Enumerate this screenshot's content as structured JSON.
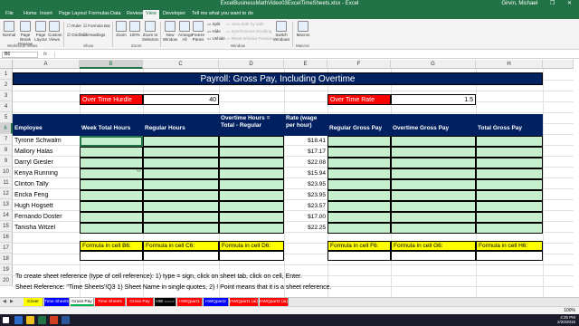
{
  "app": {
    "title": "ExcelBusinessMathVideo03ExcelTimeSheets.xlsx - Excel",
    "user": "Girvin, Michael"
  },
  "window_controls": "—  ❐  ✕",
  "ribbon_tabs": [
    "File",
    "Home",
    "Insert",
    "Page Layout",
    "Formulas",
    "Data",
    "Review",
    "View",
    "Developer",
    "Tell me what you want to do"
  ],
  "ribbon": {
    "normal": "Normal",
    "page_break": "Page Break Preview",
    "page_layout": "Page Layout",
    "custom_views": "Custom Views",
    "ruler": "Ruler",
    "formula_bar": "Formula Bar",
    "gridlines": "Gridlines",
    "headings": "Headings",
    "zoom": "Zoom",
    "zoom100": "100%",
    "zoom_sel": "Zoom to Selection",
    "new_window": "New Window",
    "arrange_all": "Arrange All",
    "freeze": "Freeze Panes",
    "split": "Split",
    "hide": "Hide",
    "unhide": "Unhide",
    "view_side": "View Side by Side",
    "sync_scroll": "Synchronous Scrolling",
    "reset_pos": "Reset Window Position",
    "switch": "Switch Windows",
    "macros": "Macros",
    "grp_views": "Workbook Views",
    "grp_show": "Show",
    "grp_zoom": "Zoom",
    "grp_window": "Window",
    "grp_macros": "Macros"
  },
  "formula_bar": {
    "name_box": "B6",
    "fx": "fx",
    "value": ""
  },
  "columns": [
    "A",
    "B",
    "C",
    "D",
    "E",
    "F",
    "G",
    "H"
  ],
  "rows": [
    "1",
    "2",
    "3",
    "4",
    "5",
    "6",
    "7",
    "8",
    "9",
    "10",
    "11",
    "12",
    "13",
    "14",
    "15",
    "16",
    "17",
    "18",
    "19",
    "20"
  ],
  "sheet": {
    "title": "Payroll: Gross Pay, Including Overtime",
    "ot_hurdle_label": "Over Time Hurdle",
    "ot_hurdle_value": "40",
    "ot_rate_label": "Over Time Rate",
    "ot_rate_value": "1.5",
    "headers": [
      "Employee",
      "Week Total Hours",
      "Regular Hours",
      "Overtime Hours = Total - Regular",
      "Rate (wage per hour)",
      "Regular Gross Pay",
      "Overtime Gross Pay",
      "Total Gross Pay"
    ],
    "employees": [
      {
        "name": "Tyrone Schwalm",
        "rate": "$18.41"
      },
      {
        "name": "Mallory Halas",
        "rate": "$17.17"
      },
      {
        "name": "Darryl Giesler",
        "rate": "$22.08"
      },
      {
        "name": "Kenya Running",
        "rate": "$15.94"
      },
      {
        "name": "Clinton Tally",
        "rate": "$23.95"
      },
      {
        "name": "Ericka Feng",
        "rate": "$23.95"
      },
      {
        "name": "Hugh Hogsett",
        "rate": "$23.57"
      },
      {
        "name": "Fernando Doster",
        "rate": "$17.00"
      },
      {
        "name": "Tanisha Witzel",
        "rate": "$22.25"
      }
    ],
    "formula_labels": [
      "Formula in cell B6:",
      "Formula in cell C6:",
      "Formula in cell D6:",
      "Formula in cell F6:",
      "Formula in cell G6:",
      "Formula in cell H6:"
    ],
    "note1": "To create sheet reference (type of cell reference): 1) type = sign, click on sheet tab, click on cell, Enter.",
    "note2": "Sheet Reference: \"Time Sheets'!Q3     1) Sheet Name in single quotes, 2) ! Point means that it is a sheet reference."
  },
  "sheet_tabs": [
    {
      "label": "Cover",
      "color": "#ffff00",
      "text": "#000000"
    },
    {
      "label": "Time Sheets",
      "color": "#0000ff",
      "text": "#ffffff"
    },
    {
      "label": "Gross Pay",
      "color": "#00b050",
      "text": "#000000"
    },
    {
      "label": "Time Sheets (ai)",
      "color": "#ff0000",
      "text": "#ffffff"
    },
    {
      "label": "Gross Pay (ai)",
      "color": "#ff0000",
      "text": "#ffffff"
    },
    {
      "label": "HW ====",
      "color": "#000000",
      "text": "#ffffff"
    },
    {
      "label": "HWQpart1",
      "color": "#ff0000",
      "text": "#ffffff"
    },
    {
      "label": "HWQpart2",
      "color": "#0000ff",
      "text": "#ffffff"
    },
    {
      "label": "HWQpart1 (ai)",
      "color": "#ff0000",
      "text": "#ffffff"
    },
    {
      "label": "HWQpart2 (ai)",
      "color": "#ff0000",
      "text": "#ffffff"
    }
  ],
  "status": {
    "zoom": "100%"
  },
  "taskbar": {
    "time": "4:25 PM",
    "date": "2/20/2015"
  },
  "colors": {
    "accent": "#217346",
    "title_bg": "#002060",
    "red": "#ff0000",
    "green": "#c6efce",
    "yellow": "#ffff00"
  }
}
